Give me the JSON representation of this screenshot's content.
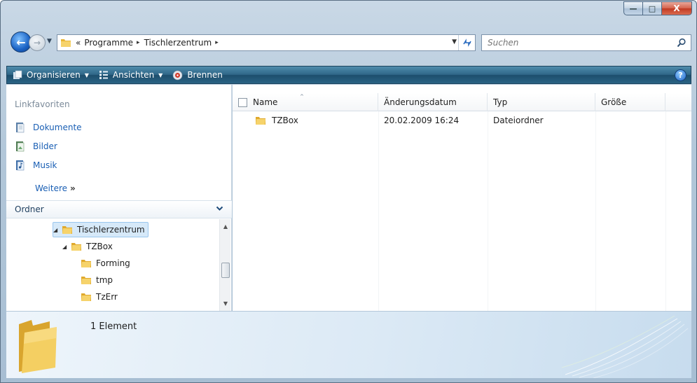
{
  "window": {
    "min_glyph": "—",
    "max_glyph": "□",
    "close_glyph": "X"
  },
  "nav": {
    "back_glyph": "←",
    "forward_glyph": "→",
    "recent_glyph": "▼",
    "address": {
      "overflow": "«",
      "crumbs": [
        "Programme",
        "Tischlerzentrum"
      ],
      "separator": "▸",
      "dropdown_glyph": "▼",
      "refresh_glyph": "⁴⁄"
    },
    "search": {
      "placeholder": "Suchen"
    }
  },
  "toolbar": {
    "organize": "Organisieren",
    "views": "Ansichten",
    "burn": "Brennen",
    "caret": "▼",
    "help": "?"
  },
  "left": {
    "favorites_header": "Linkfavoriten",
    "favorites": [
      {
        "label": "Dokumente",
        "icon": "documents-icon"
      },
      {
        "label": "Bilder",
        "icon": "pictures-icon"
      },
      {
        "label": "Musik",
        "icon": "music-icon"
      }
    ],
    "more": "Weitere",
    "more_glyph": "»",
    "folders_header": "Ordner",
    "folders_chevron": "⌄",
    "tree": [
      {
        "label": "Tischlerzentrum",
        "expanded": true,
        "selected": true
      },
      {
        "label": "TZBox",
        "expanded": true,
        "selected": false
      },
      {
        "label": "Forming",
        "expanded": false,
        "selected": false
      },
      {
        "label": "tmp",
        "expanded": false,
        "selected": false
      },
      {
        "label": "TzErr",
        "expanded": false,
        "selected": false
      }
    ],
    "tree_expand_glyph": "◢",
    "scroll_up": "▲",
    "scroll_down": "▼"
  },
  "list": {
    "columns": [
      "Name",
      "Änderungsdatum",
      "Typ",
      "Größe"
    ],
    "sort_glyph": "^",
    "rows": [
      {
        "name": "TZBox",
        "date": "20.02.2009 16:24",
        "type": "Dateiordner",
        "size": ""
      }
    ]
  },
  "details": {
    "count": "1 Element"
  },
  "colors": {
    "toolbar": "#2f6788",
    "link": "#1a5fb4",
    "folder": "#f0c44e",
    "selection": "#d6e9f9"
  }
}
